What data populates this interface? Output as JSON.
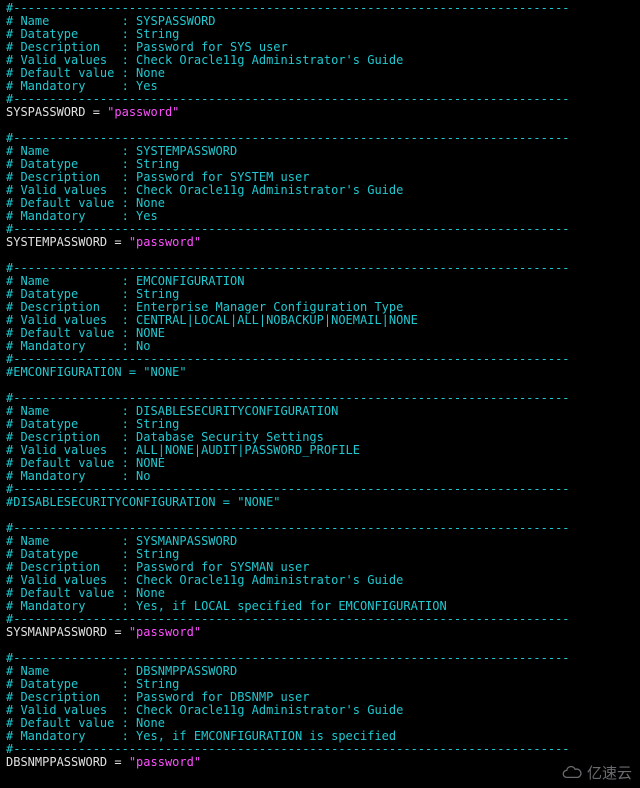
{
  "dash": "#-----------------------------------------------------------------------------",
  "blank": "",
  "blocks": [
    {
      "name": "SYSPASSWORD",
      "datatype": "String",
      "description": "Password for SYS user",
      "valid_values": "Check Oracle11g Administrator's Guide",
      "default_value": "None",
      "mandatory": "Yes",
      "assignment_active": true,
      "assign_var": "SYSPASSWORD",
      "assign_value": "\"password\"",
      "assign_inactive_line": ""
    },
    {
      "name": "SYSTEMPASSWORD",
      "datatype": "String",
      "description": "Password for SYSTEM user",
      "valid_values": "Check Oracle11g Administrator's Guide",
      "default_value": "None",
      "mandatory": "Yes",
      "assignment_active": true,
      "assign_var": "SYSTEMPASSWORD",
      "assign_value": "\"password\"",
      "assign_inactive_line": ""
    },
    {
      "name": "EMCONFIGURATION",
      "datatype": "String",
      "description": "Enterprise Manager Configuration Type",
      "valid_values": "CENTRAL|LOCAL|ALL|NOBACKUP|NOEMAIL|NONE",
      "default_value": "NONE",
      "mandatory": "No",
      "assignment_active": false,
      "assign_var": "",
      "assign_value": "",
      "assign_inactive_line": "#EMCONFIGURATION = \"NONE\""
    },
    {
      "name": "DISABLESECURITYCONFIGURATION",
      "datatype": "String",
      "description": "Database Security Settings",
      "valid_values": "ALL|NONE|AUDIT|PASSWORD_PROFILE",
      "default_value": "NONE",
      "mandatory": "No",
      "assignment_active": false,
      "assign_var": "",
      "assign_value": "",
      "assign_inactive_line": "#DISABLESECURITYCONFIGURATION = \"NONE\""
    },
    {
      "name": "SYSMANPASSWORD",
      "datatype": "String",
      "description": "Password for SYSMAN user",
      "valid_values": "Check Oracle11g Administrator's Guide",
      "default_value": "None",
      "mandatory": "Yes, if LOCAL specified for EMCONFIGURATION",
      "assignment_active": true,
      "assign_var": "SYSMANPASSWORD",
      "assign_value": "\"password\"",
      "assign_inactive_line": ""
    },
    {
      "name": "DBSNMPPASSWORD",
      "datatype": "String",
      "description": "Password for DBSNMP user",
      "valid_values": "Check Oracle11g Administrator's Guide",
      "default_value": "None",
      "mandatory": "Yes, if EMCONFIGURATION is specified",
      "assignment_active": true,
      "assign_var": "DBSNMPPASSWORD",
      "assign_value": "\"password\"",
      "assign_inactive_line": ""
    }
  ],
  "labels": {
    "name": "# Name          : ",
    "datatype": "# Datatype      : ",
    "description": "# Description   : ",
    "valid_values": "# Valid values  : ",
    "default_value": "# Default value : ",
    "mandatory": "# Mandatory     : ",
    "eq": " = "
  },
  "watermark": "亿速云"
}
